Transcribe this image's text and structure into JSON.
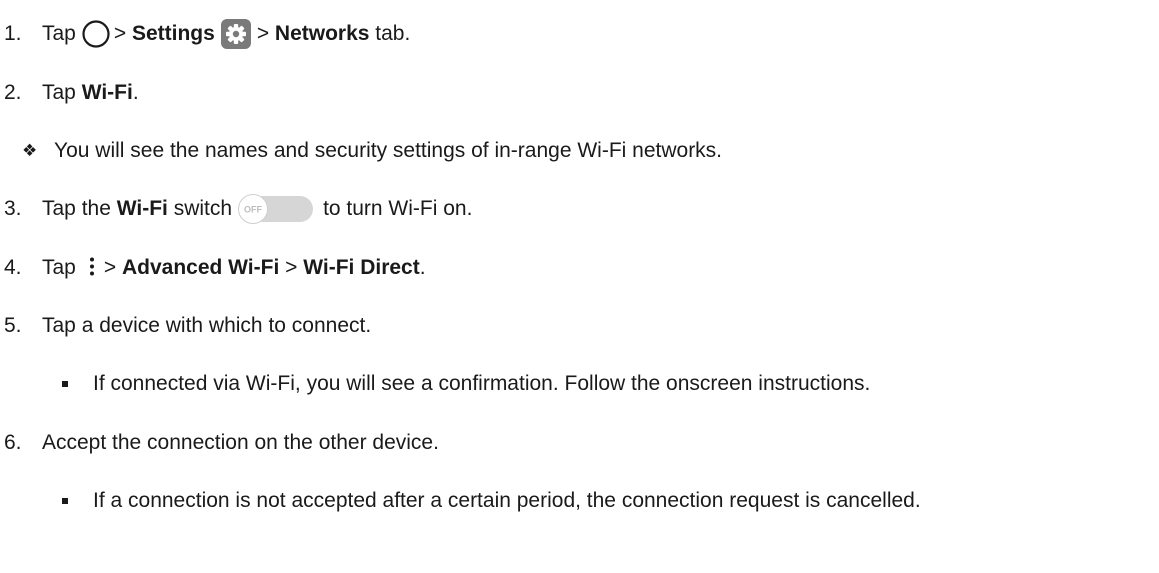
{
  "steps": {
    "s1": {
      "num": "1.",
      "tap": "Tap",
      "sep1": "> ",
      "settings": "Settings",
      "sep2": "> ",
      "networks": "Networks",
      "tail": " tab."
    },
    "s2": {
      "num": "2.",
      "tap": "Tap ",
      "wifi": "Wi-Fi",
      "tail": "."
    },
    "note1": {
      "text": "You will see the names and security settings of in-range Wi-Fi networks."
    },
    "s3": {
      "num": "3.",
      "pre": "Tap the ",
      "wifi": "Wi-Fi",
      "mid": " switch",
      "tail": "to turn Wi-Fi on.",
      "switch_text": "OFF"
    },
    "s4": {
      "num": "4.",
      "tap": "Tap",
      "sep1": "> ",
      "advanced": "Advanced Wi-Fi",
      "sep2": " > ",
      "direct": "Wi-Fi Direct",
      "tail": "."
    },
    "s5": {
      "num": "5.",
      "text": "Tap a device with which to connect."
    },
    "sub5": {
      "text": "If connected via Wi-Fi, you will see a confirmation. Follow the onscreen instructions."
    },
    "s6": {
      "num": "6.",
      "text": "Accept the connection on the other device."
    },
    "sub6": {
      "text": "If a connection is not accepted after a certain period, the connection request is cancelled."
    }
  },
  "icons": {
    "home": "home-circle-icon",
    "settings": "settings-gear-icon",
    "switch": "toggle-switch-off-icon",
    "more": "more-vertical-icon",
    "note_bullet": "diamond-bullet-icon",
    "sub_bullet": "square-bullet-icon"
  },
  "colors": {
    "text": "#1a1a1a",
    "settings_icon_bg": "#7a7a7a",
    "switch_track": "#d6d6d6",
    "switch_knob": "#ffffff"
  }
}
